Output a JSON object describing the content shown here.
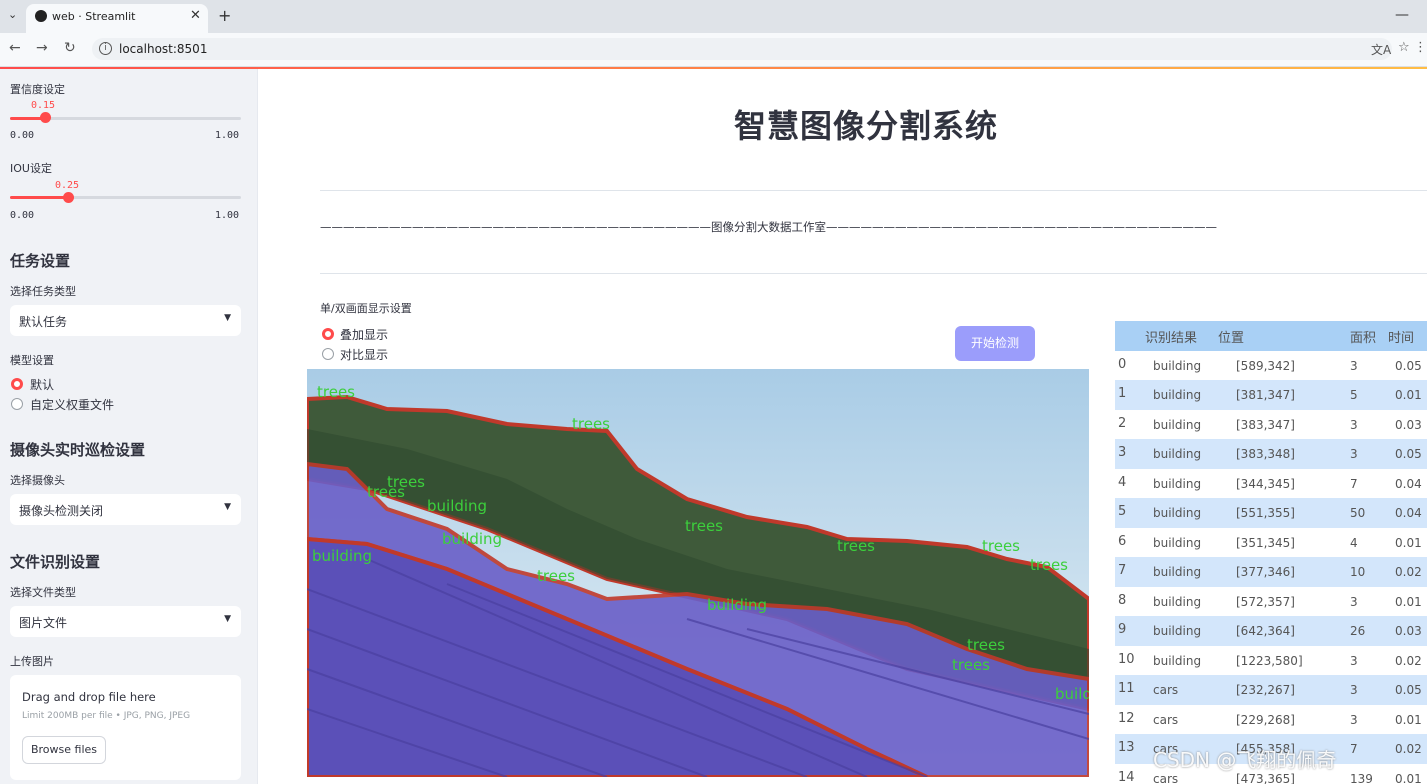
{
  "browser": {
    "tab_title": "web · Streamlit",
    "url": "localhost:8501",
    "new_tab": "+",
    "close": "✕",
    "menu_caret": "⌄",
    "minimize": "—",
    "back": "←",
    "forward": "→",
    "reload": "↻",
    "info": "i",
    "translate": "⽂A",
    "star": "☆",
    "more": "⋮"
  },
  "sidebar": {
    "conf_label": "置信度设定",
    "conf_value": 0.15,
    "conf_value_text": "0.15",
    "conf_min": "0.00",
    "conf_max": "1.00",
    "iou_label": "IOU设定",
    "iou_value": 0.25,
    "iou_value_text": "0.25",
    "iou_min": "0.00",
    "iou_max": "1.00",
    "task_heading": "任务设置",
    "task_type_label": "选择任务类型",
    "task_type_value": "默认任务",
    "model_label": "模型设置",
    "model_options": [
      "默认",
      "自定义权重文件"
    ],
    "model_selected": 0,
    "camera_heading": "摄像头实时巡检设置",
    "camera_label": "选择摄像头",
    "camera_value": "摄像头检测关闭",
    "file_heading": "文件识别设置",
    "file_type_label": "选择文件类型",
    "file_type_value": "图片文件",
    "upload_label": "上传图片",
    "upload_drag": "Drag and drop file here",
    "upload_limit": "Limit 200MB per file • JPG, PNG, JPEG",
    "upload_button": "Browse files"
  },
  "main": {
    "title": "智慧图像分割系统",
    "studio": "——————————————————————————————————图像分割大数据工作室——————————————————————————————————",
    "mode_label": "单/双画面显示设置",
    "mode_options": [
      "叠加显示",
      "对比显示"
    ],
    "mode_selected": 0,
    "start_button": "开始检测",
    "overlay_labels": [
      "trees",
      "trees",
      "trees",
      "trees",
      "building",
      "trees",
      "trees",
      "building",
      "building",
      "trees",
      "trees",
      "trees",
      "building",
      "trees",
      "trees",
      "building"
    ]
  },
  "table": {
    "headers": [
      "",
      "识别结果",
      "位置",
      "面积",
      "时间"
    ],
    "rows": [
      [
        "0",
        "building",
        "[589,342]",
        "3",
        "0.05"
      ],
      [
        "1",
        "building",
        "[381,347]",
        "5",
        "0.01"
      ],
      [
        "2",
        "building",
        "[383,347]",
        "3",
        "0.03"
      ],
      [
        "3",
        "building",
        "[383,348]",
        "3",
        "0.05"
      ],
      [
        "4",
        "building",
        "[344,345]",
        "7",
        "0.04"
      ],
      [
        "5",
        "building",
        "[551,355]",
        "50",
        "0.04"
      ],
      [
        "6",
        "building",
        "[351,345]",
        "4",
        "0.01"
      ],
      [
        "7",
        "building",
        "[377,346]",
        "10",
        "0.02"
      ],
      [
        "8",
        "building",
        "[572,357]",
        "3",
        "0.01"
      ],
      [
        "9",
        "building",
        "[642,364]",
        "26",
        "0.03"
      ],
      [
        "10",
        "building",
        "[1223,580]",
        "3",
        "0.02"
      ],
      [
        "11",
        "cars",
        "[232,267]",
        "3",
        "0.05"
      ],
      [
        "12",
        "cars",
        "[229,268]",
        "3",
        "0.01"
      ],
      [
        "13",
        "cars",
        "[455,358]",
        "7",
        "0.02"
      ],
      [
        "14",
        "cars",
        "[473,365]",
        "139",
        "0.01"
      ]
    ]
  },
  "watermark": "CSDN @飞翔的佩奇",
  "colors": {
    "accent": "#ff4b4b",
    "button": "#9b9dfb",
    "table_header": "#a9d0f5",
    "table_alt": "#d3e6fb",
    "mask_purple": "#6a5fc8",
    "mask_border": "#c0392b",
    "label_green": "#3ccf3c"
  }
}
